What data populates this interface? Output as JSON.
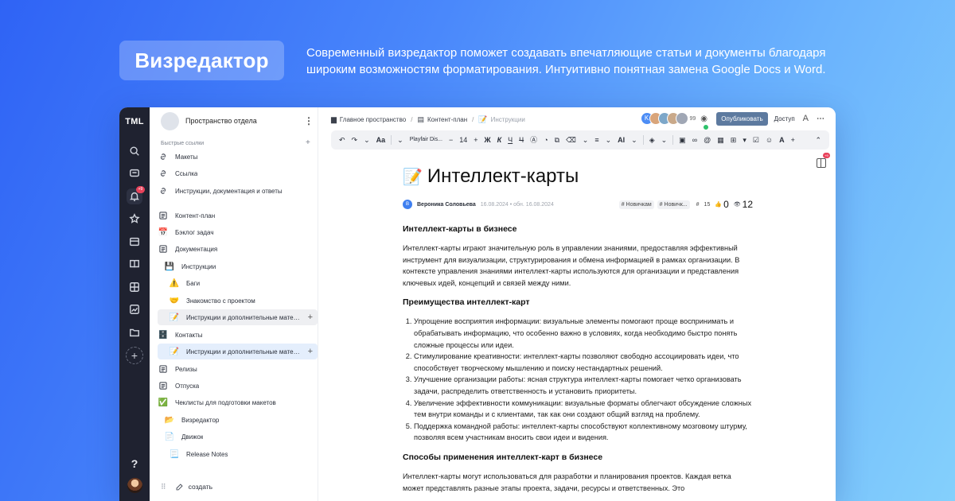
{
  "hero": {
    "badge": "Визредактор",
    "text": "Современный визредактор поможет создавать впечатляющие статьи и документы благодаря широким возможностям форматирования. Интуитивно понятная замена Google Docs и Word."
  },
  "rail": {
    "logo": "TML",
    "bell_badge": "+9",
    "help": "?",
    "add": "+"
  },
  "sidebar": {
    "space_title": "Пространство отдела",
    "quick_links_label": "Быстрые ссылки",
    "quick_links": [
      {
        "label": "Макеты",
        "icon": "link-icon"
      },
      {
        "label": "Ссылка",
        "icon": "link-icon"
      },
      {
        "label": "Инструкции, документация и ответы",
        "icon": "link-icon"
      }
    ],
    "tree": [
      {
        "label": "Контент-план",
        "icon": "doc-icon"
      },
      {
        "label": "Бэклог задач",
        "icon": "calendar-icon",
        "glyph": "📅"
      },
      {
        "label": "Документация",
        "icon": "doc-icon"
      },
      {
        "label": "Инструкции",
        "icon": "floppy-icon",
        "glyph": "💾"
      },
      {
        "label": "Баги",
        "icon": "warning-icon",
        "glyph": "⚠️"
      },
      {
        "label": "Знакомство с проектом",
        "icon": "handshake-icon",
        "glyph": "🤝"
      },
      {
        "label": "Инструкции и дополнительные материалы",
        "icon": "memo-icon",
        "glyph": "📝"
      },
      {
        "label": "Контакты",
        "icon": "cabinet-icon",
        "glyph": "🗄️"
      },
      {
        "label": "Инструкции и дополнительные материалы",
        "icon": "memo-icon",
        "glyph": "📝"
      },
      {
        "label": "Релизы",
        "icon": "doc-icon"
      },
      {
        "label": "Отпуска",
        "icon": "doc-icon"
      },
      {
        "label": "Чеклисты для подготовки макетов",
        "icon": "check-icon",
        "glyph": "✅"
      },
      {
        "label": "Визредактор",
        "icon": "folder-icon",
        "glyph": "📂"
      },
      {
        "label": "Движок",
        "icon": "page-icon",
        "glyph": "📄"
      },
      {
        "label": "Release Notes",
        "icon": "scroll-icon",
        "glyph": "📃"
      }
    ],
    "create_label": "создать"
  },
  "breadcrumbs": [
    "Главное пространство",
    "Контент-план",
    "Инструкции"
  ],
  "topbar": {
    "viewer_initial": "K",
    "viewers_count": "99",
    "publish": "Опубликовать",
    "access": "Доступ"
  },
  "toolbar": {
    "font": "Playfair Dis...",
    "size": "14",
    "bold": "Ж",
    "italic": "К",
    "underline": "Ч",
    "strike": "Ч",
    "ai": "AI"
  },
  "document": {
    "emoji": "📝",
    "title": "Интеллект-карты",
    "author_initial": "В",
    "author": "Вероника Соловьева",
    "dates": "16.08.2024 • обн. 16.08.2024",
    "tags": [
      "# Новичкам",
      "# Новичк..."
    ],
    "comments": "15",
    "likes": "0",
    "views": "12",
    "h1": "Интеллект-карты в бизнесе",
    "p1": "Интеллект-карты играют значительную роль в управлении знаниями, предоставляя эффективный инструмент для визуализации, структурирования и обмена информацией в рамках организации. В контексте управления знаниями интеллект-карты используются для организации и представления ключевых идей, концепций и связей между ними.",
    "h2": "Преимущества интеллект-карт",
    "list": [
      "Упрощение восприятия информации: визуальные элементы помогают проще воспринимать и обрабатывать информацию, что особенно важно в условиях, когда необходимо быстро понять сложные процессы или идеи.",
      "Стимулирование креативности: интеллект-карты позволяют свободно ассоциировать идеи, что способствует творческому мышлению и поиску нестандартных решений.",
      "Улучшение организации работы: ясная структура интеллект-карты помогает четко организовать задачи, распределить ответственность и установить приоритеты.",
      "Увеличение эффективности коммуникации: визуальные форматы облегчают обсуждение сложных тем внутри команды и с клиентами, так как они создают общий взгляд на проблему.",
      "Поддержка командной работы: интеллект-карты способствуют коллективному мозговому штурму, позволяя всем участникам вносить свои идеи и видения."
    ],
    "h3": "Способы применения интеллект-карт в бизнесе",
    "p2": "Интеллект-карты могут использоваться для разработки и планирования проектов. Каждая ветка может представлять разные этапы проекта, задачи, ресурсы и ответственных. Это"
  },
  "colors": {
    "accent": "#4d8df5",
    "publish": "#5d7a9f",
    "rail": "#1f2230",
    "badge": "#e8425b"
  }
}
